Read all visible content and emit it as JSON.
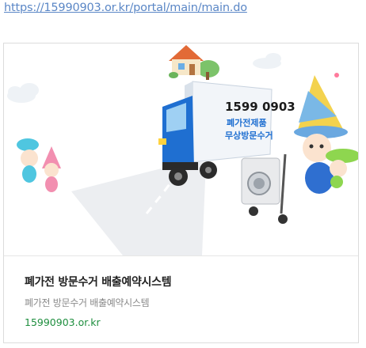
{
  "url_link": "https://15990903.or.kr/portal/main/main.do",
  "card": {
    "title": "폐가전 방문수거 배출예약시스템",
    "description": "폐가전 방문수거 배출예약시스템",
    "domain": "15990903.or.kr",
    "image": {
      "truck_phone": "1599 0903",
      "truck_line1": "폐가전제품",
      "truck_line2": "무상방문수거"
    }
  },
  "colors": {
    "link": "#5b87c6",
    "domain_green": "#1e8e3e",
    "truck_blue": "#1f6fd1"
  }
}
